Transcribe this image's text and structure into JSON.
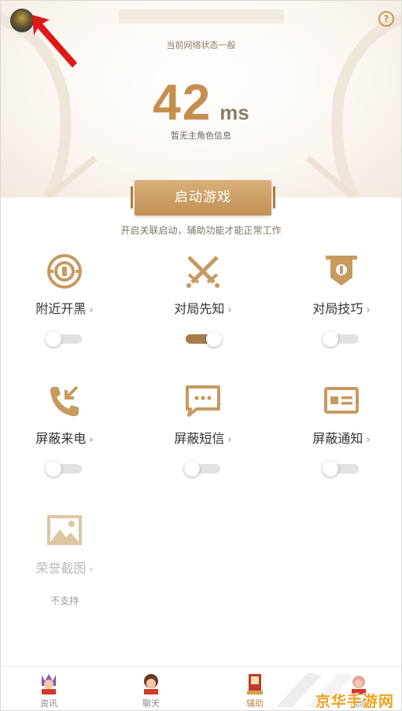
{
  "header": {
    "network_status": "当前网络状态一般",
    "ping_value": "42",
    "ping_unit": "ms",
    "role_info": "暂无主角色信息",
    "help_icon": "question-circle-icon",
    "avatar_icon": "user-avatar"
  },
  "start": {
    "label": "启动游戏",
    "hint": "开启关联启动，辅助功能才能正常工作"
  },
  "features": [
    {
      "label": "附近开黑",
      "icon": "target-icon",
      "toggle_on": false
    },
    {
      "label": "对局先知",
      "icon": "crossed-swords-icon",
      "toggle_on": true
    },
    {
      "label": "对局技巧",
      "icon": "banner-icon",
      "toggle_on": false
    },
    {
      "label": "屏蔽来电",
      "icon": "incoming-call-icon",
      "toggle_on": false
    },
    {
      "label": "屏蔽短信",
      "icon": "message-icon",
      "toggle_on": false
    },
    {
      "label": "屏蔽通知",
      "icon": "notification-card-icon",
      "toggle_on": false
    },
    {
      "label": "荣誉截图",
      "icon": "image-icon",
      "status": "不支持"
    }
  ],
  "chevron": "›",
  "tabs": [
    {
      "label": "资讯",
      "active": false
    },
    {
      "label": "聊天",
      "active": false
    },
    {
      "label": "辅助",
      "active": true
    },
    {
      "label": "战绩",
      "active": false
    }
  ],
  "watermark": {
    "text": "京华手游网"
  },
  "colors": {
    "accent": "#c48f4e",
    "button": "#c99a5e",
    "toggle_on": "#a87c48"
  }
}
